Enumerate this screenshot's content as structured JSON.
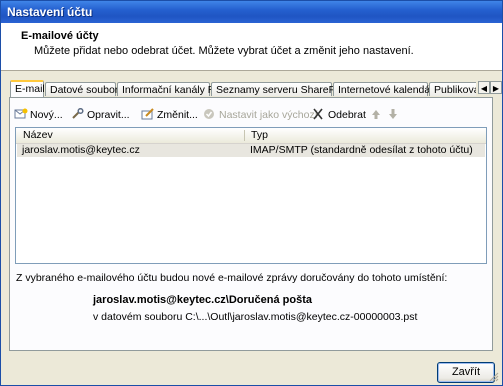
{
  "window": {
    "title": "Nastavení účtu"
  },
  "header": {
    "title": "E-mailové účty",
    "description": "Můžete přidat nebo odebrat účet. Můžete vybrat účet a změnit jeho nastavení."
  },
  "tabs": [
    {
      "label": "E-mail",
      "active": true
    },
    {
      "label": "Datové soubory"
    },
    {
      "label": "Informační kanály RSS"
    },
    {
      "label": "Seznamy serveru SharePoint"
    },
    {
      "label": "Internetové kalendáře"
    },
    {
      "label": "Publikova"
    }
  ],
  "toolbar": {
    "new_label": "Nový...",
    "repair_label": "Opravit...",
    "change_label": "Změnit...",
    "set_default_label": "Nastavit jako výchozí",
    "remove_label": "Odebrat",
    "icons": {
      "new": "new-account-icon",
      "repair": "repair-icon",
      "change": "change-icon",
      "set_default": "checkmark-icon",
      "remove": "remove-x-icon",
      "up": "arrow-up-icon",
      "down": "arrow-down-icon"
    }
  },
  "list": {
    "columns": [
      "Název",
      "Typ"
    ],
    "rows": [
      {
        "name": "jaroslav.motis@keytec.cz",
        "type": "IMAP/SMTP (standardně odesílat z tohoto účtu)"
      }
    ]
  },
  "delivery": {
    "info": "Z vybraného e-mailového účtu budou nové e-mailové zprávy doručovány do tohoto umístění:",
    "location": "jaroslav.motis@keytec.cz\\Doručená pošta",
    "file": "v datovém souboru C:\\...\\Outl\\jaroslav.motis@keytec.cz-00000003.pst"
  },
  "footer": {
    "close_label": "Zavřít"
  },
  "colors": {
    "titlebar": "#2560cf",
    "tab_active_border": "#ffc83c",
    "selected_row": "#e8e6df"
  }
}
